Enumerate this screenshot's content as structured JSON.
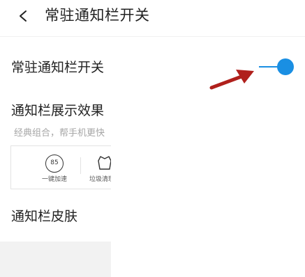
{
  "header": {
    "title": "常驻通知栏开关",
    "back_icon": "chevron-left-icon"
  },
  "settings": {
    "persistent_switch": {
      "label": "常驻通知栏开关",
      "on": true,
      "accent": "#1a8fe3"
    },
    "display_effect": {
      "label": "通知栏展示效果",
      "description": "经典组合，帮手机更快",
      "preview": {
        "items": [
          {
            "value": "85",
            "label": "一键加速",
            "icon": "speed-ring-icon"
          },
          {
            "label": "垃圾清理",
            "icon": "trash-icon"
          }
        ]
      }
    },
    "skin": {
      "label": "通知栏皮肤"
    }
  },
  "annotation": {
    "icon": "red-arrow-icon",
    "color": "#b0201c"
  }
}
